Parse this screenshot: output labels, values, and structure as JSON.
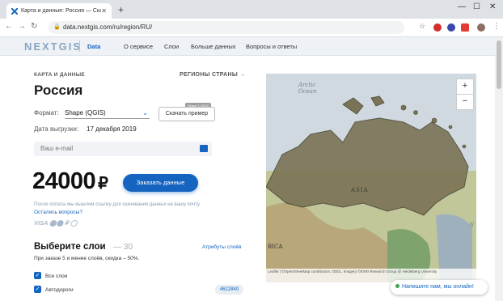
{
  "browser": {
    "tab_title": "Карта и данные: Россия — Скач",
    "url": "data.nextgis.com/ru/region/RU/"
  },
  "header": {
    "logo": "NEXTGIS",
    "menu": [
      "Data",
      "О сервисе",
      "Слои",
      "Больше данных",
      "Вопросы и ответы"
    ]
  },
  "product": {
    "eyebrow": "КАРТА И ДАННЫЕ",
    "regions_link": "РЕГИОНЫ СТРАНЫ →",
    "title": "Россия",
    "format_label": "Формат:",
    "format_value": "Shape (QGIS)",
    "sample_button": "Скачать пример",
    "tooltip": "Shape 1 QGIS",
    "date_label": "Дата выгрузки:",
    "date_value": "17 декабря 2019",
    "email_placeholder": "Ваш e-mail",
    "price": "24000",
    "currency": "₽",
    "order_button": "Заказать данные",
    "note": "После оплаты мы вышлем ссылку для скачивания данных на вашу почту.",
    "questions_link": "Остались вопросы?",
    "payments": "VISA ⬤⬤ ₽ ◯"
  },
  "layers": {
    "title": "Выберите слои",
    "count": "— 30",
    "attrs_link": "Атрибуты слоёв",
    "discount": "При заказе 5 и менее слоёв, скидка – 50%.",
    "items": [
      {
        "label": "Все слои",
        "checked": true
      },
      {
        "label": "Автодороги",
        "checked": true,
        "count": "4622840"
      }
    ]
  },
  "map": {
    "labels": {
      "arctic": "Arctic\nOcean",
      "asia": "ASIA",
      "africa": "RICA",
      "ocean": "N"
    },
    "zoom_in": "+",
    "zoom_out": "−",
    "attribution": "Leaflet | ©OpenStreetMap contributors, ODbL, Imagery ©ESRI Research Group @ Heidelberg University"
  },
  "chat": "Напишите нам, мы онлайн!",
  "colors": {
    "accent": "#1565c0",
    "russia_fill": "#7a7355"
  }
}
